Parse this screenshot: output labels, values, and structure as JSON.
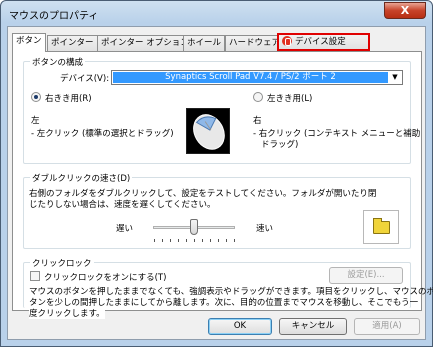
{
  "window": {
    "title": "マウスのプロパティ",
    "close_glyph": "X"
  },
  "tabs": [
    {
      "label": "ボタン"
    },
    {
      "label": "ポインター"
    },
    {
      "label": "ポインター オプション"
    },
    {
      "label": "ホイール"
    },
    {
      "label": "ハードウェア"
    },
    {
      "label": "デバイス設定"
    }
  ],
  "button_config": {
    "title": "ボタンの構成",
    "device_label": "デバイス(V):",
    "device_value": "Synaptics Scroll Pad V7.4 / PS/2 ポート 2",
    "right_hand_label": "右きき用(R)",
    "left_hand_label": "左きき用(L)",
    "left_heading": "左",
    "left_desc": "- 左クリック (標準の選択とドラッグ)",
    "right_heading": "右",
    "right_desc_1": "- 右クリック (コンテキスト メニューと補助",
    "right_desc_2": "ドラッグ)"
  },
  "double_click": {
    "title": "ダブルクリックの速さ(D)",
    "desc_1": "右側のフォルダをダブルクリックして、設定をテストしてください。フォルダが開いたり閉",
    "desc_2": "じたりしない場合は、速度を遅くしてください。",
    "slow": "遅い",
    "fast": "速い",
    "speed_fraction": 0.5
  },
  "click_lock": {
    "title": "クリックロック",
    "checkbox_label": "クリックロックをオンにする(T)",
    "settings_button": "設定(E)...",
    "desc_1": "マウスのボタンを押したままでなくても、強調表示やドラッグができます。項目をクリックし、マウスのボ",
    "desc_2": "タンを少しの間押したままにしてから離します。次に、目的の位置までマウスを移動し、そこでもう一",
    "desc_3": "度クリックします。"
  },
  "footer": {
    "ok": "OK",
    "cancel": "キャンセル",
    "apply": "適用(A)"
  },
  "colors": {
    "highlight_tab_border": "#e00000",
    "selection": "#3399ff"
  }
}
